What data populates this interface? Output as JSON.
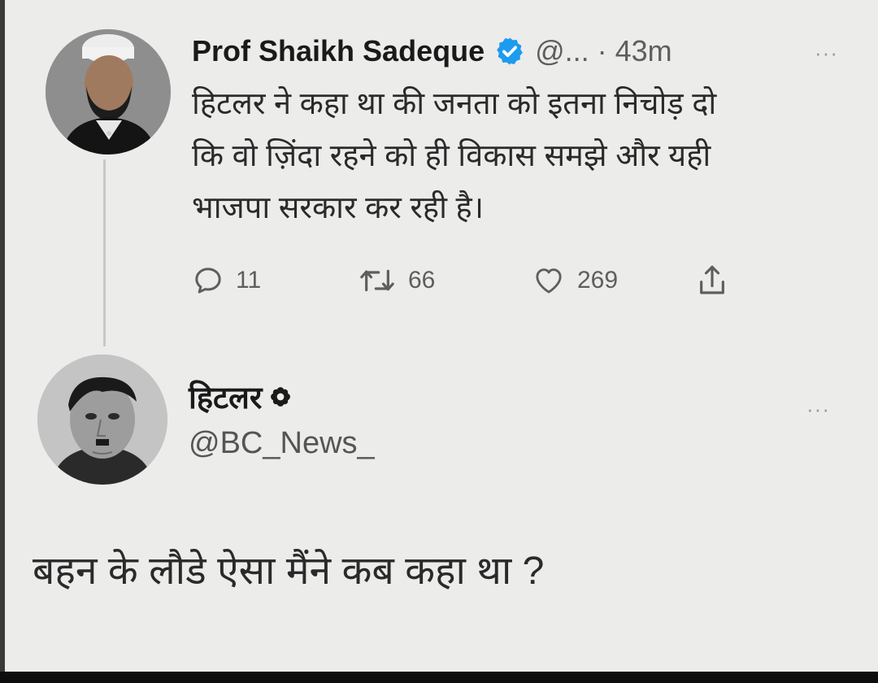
{
  "tweet1": {
    "author_name": "Prof Shaikh Sadeque",
    "handle_time": "@... · 43m",
    "body_lines": [
      "हिटलर ने कहा था की जनता को इतना निचोड़ दो",
      "कि वो ज़िंदा रहने को ही विकास समझे और यही",
      "भाजपा सरकार कर रही है।"
    ],
    "reply_count": "11",
    "retweet_count": "66",
    "like_count": "269",
    "more_label": "···",
    "verified_color": "#1d9bf0"
  },
  "tweet2": {
    "author_name": "हिटलर",
    "handle": "@BC_News_",
    "more_label": "···",
    "body": "बहन के लौडे ऐसा मैंने कब कहा था ?"
  },
  "icons": {
    "reply": "speech-bubble-icon",
    "retweet": "retweet-icon",
    "like": "heart-icon",
    "share": "share-icon",
    "verified": "verified-badge-icon",
    "name_decoration": "flower-icon"
  }
}
